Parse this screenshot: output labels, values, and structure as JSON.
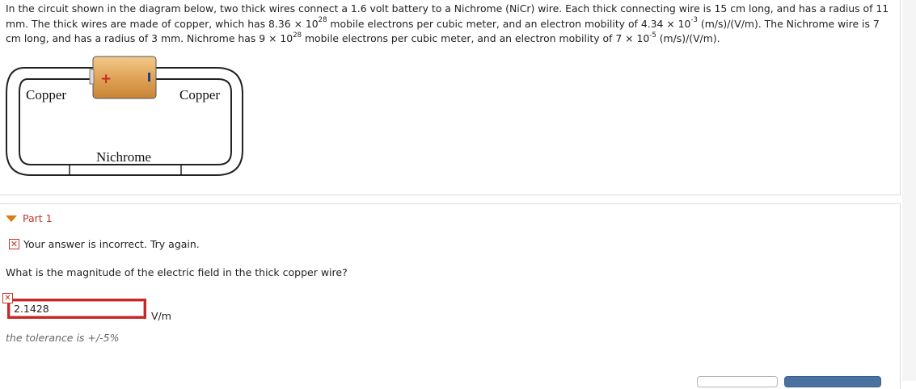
{
  "problem": {
    "seg1": "In the circuit shown in the diagram below, two thick wires connect a 1.6 volt battery to a Nichrome (NiCr) wire. Each thick connecting wire is 15 cm long, and has a radius of 11 mm. The thick wires are made of copper, which has 8.36 × 10",
    "sup1": "28",
    "seg2": " mobile electrons per cubic meter, and an electron mobility of 4.34 × 10",
    "sup2": "-3",
    "seg3": " (m/s)/(V/m). The Nichrome wire is 7 cm long, and has a radius of 3 mm. Nichrome has 9 × 10",
    "sup3": "28",
    "seg4": " mobile electrons per cubic meter, and an electron mobility of 7 × 10",
    "sup4": "-5",
    "seg5": " (m/s)/(V/m)."
  },
  "diagram": {
    "left_label": "Copper",
    "right_label": "Copper",
    "bottom_label": "Nichrome",
    "battery_plus": "+",
    "battery_minus": "−"
  },
  "part": {
    "title": "Part 1",
    "feedback_icon": "✕",
    "feedback": "Your answer is incorrect.  Try again.",
    "question": "What is the magnitude of the electric field in the thick copper wire?",
    "answer_value": "2.1428",
    "unit": "V/m",
    "tolerance": "the tolerance is +/-5%",
    "error_icon": "✕"
  },
  "colors": {
    "error": "#c62828",
    "part_title": "#c0392b",
    "caret": "#e07a14",
    "battery": "#e0a458"
  }
}
